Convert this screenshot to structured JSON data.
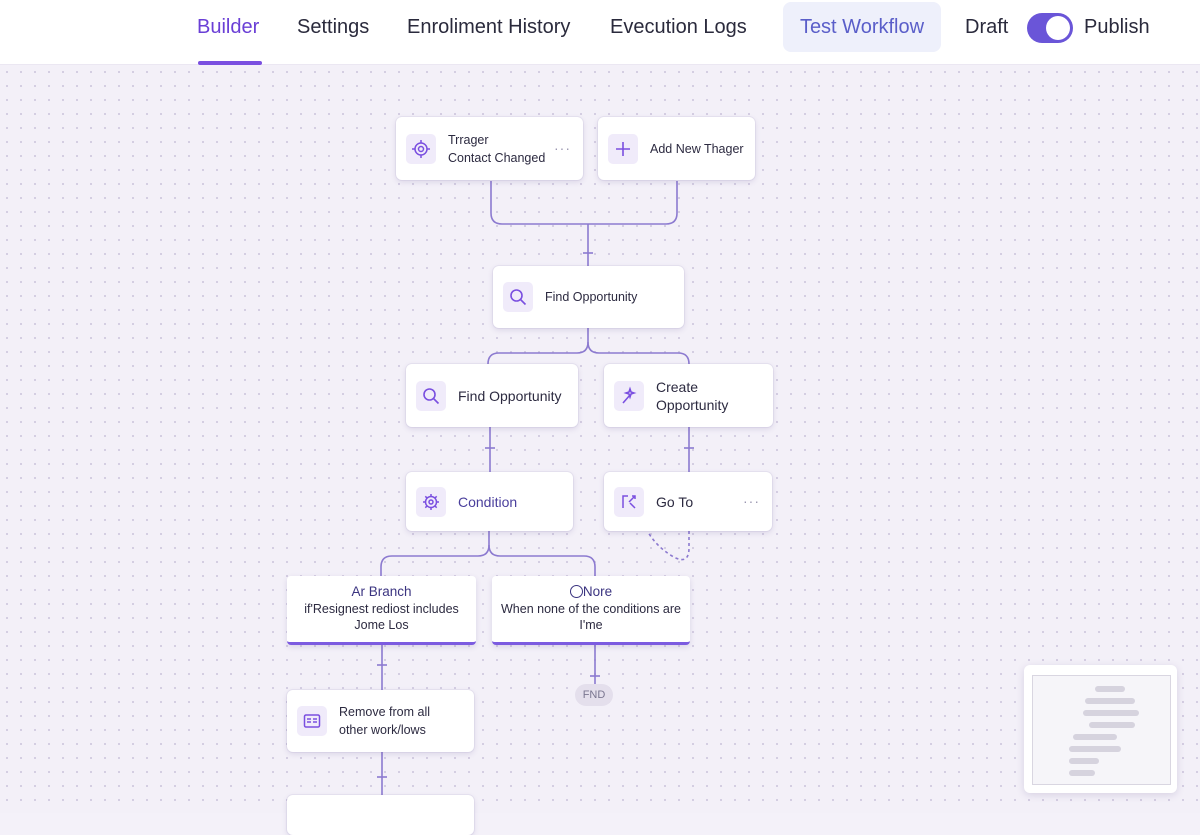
{
  "header": {
    "tabs": [
      {
        "label": "Builder",
        "active": true
      },
      {
        "label": "Settings",
        "active": false
      },
      {
        "label": "Enroliment History",
        "active": false
      },
      {
        "label": "Evecution Logs",
        "active": false
      }
    ],
    "test_button": "Test Workflow",
    "draft_label": "Draft",
    "publish_label": "Publish",
    "publish_toggle_on": true
  },
  "colors": {
    "accent": "#6a3fd6",
    "toggle": "#6a55d8",
    "connector": "#8c7ad0",
    "branch_border": "#7c5be0"
  },
  "nodes": {
    "trigger": {
      "title": "Trrager",
      "subtitle": "Contact Changed",
      "icon": "target-icon",
      "more": "···"
    },
    "add_trigger": {
      "label": "Add New Thager",
      "icon": "plus-icon"
    },
    "find_opportunity_1": {
      "label": "Find Opportunity",
      "icon": "search-icon"
    },
    "find_opportunity_2": {
      "label": "Find Opportunity",
      "icon": "search-icon"
    },
    "create_opportunity": {
      "label": "Create Opportunity",
      "icon": "wand-icon"
    },
    "condition": {
      "label": "Condition",
      "icon": "gear-icon"
    },
    "go_to": {
      "label": "Go To",
      "icon": "goto-icon",
      "more": "···"
    },
    "branch_a": {
      "title": "Ar Branch",
      "line1": "if'Resignest rediost includes",
      "line2": "Jome Los"
    },
    "branch_none": {
      "title": "Nore",
      "line1": "When none of the conditions are",
      "line2": "I'me"
    },
    "end": {
      "label": "FND"
    },
    "remove": {
      "line1": "Remove from all",
      "line2": "other work/lows",
      "icon": "remove-icon"
    }
  }
}
